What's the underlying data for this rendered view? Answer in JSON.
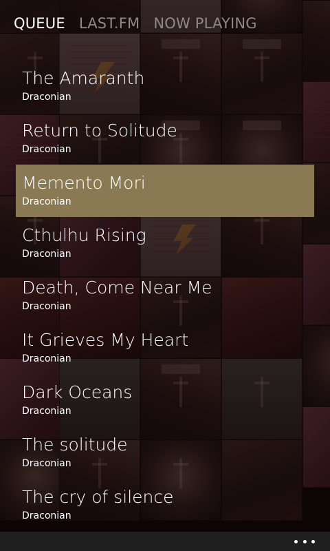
{
  "pivot": {
    "items": [
      {
        "label": "QUEUE",
        "active": true
      },
      {
        "label": "LAST.FM",
        "active": false
      },
      {
        "label": "NOW PLAYING",
        "active": false
      }
    ]
  },
  "queue": {
    "tracks": [
      {
        "title": "The Amaranth",
        "artist": "Draconian"
      },
      {
        "title": "Return to Solitude",
        "artist": "Draconian"
      },
      {
        "title": "Memento Mori",
        "artist": "Draconian",
        "selected": true
      },
      {
        "title": "Cthulhu Rising",
        "artist": "Draconian"
      },
      {
        "title": "Death, Come Near Me",
        "artist": "Draconian"
      },
      {
        "title": "It Grieves My Heart",
        "artist": "Draconian"
      },
      {
        "title": "Dark Oceans",
        "artist": "Draconian"
      },
      {
        "title": "The solitude",
        "artist": "Draconian"
      },
      {
        "title": "The cry of silence",
        "artist": "Draconian"
      }
    ]
  },
  "appbar": {
    "more_icon": "ellipsis-icon"
  },
  "colors": {
    "selected_background": "#8a7a54",
    "inactive_pivot": "#8f8a87",
    "appbar_background": "#1f1f1f"
  }
}
